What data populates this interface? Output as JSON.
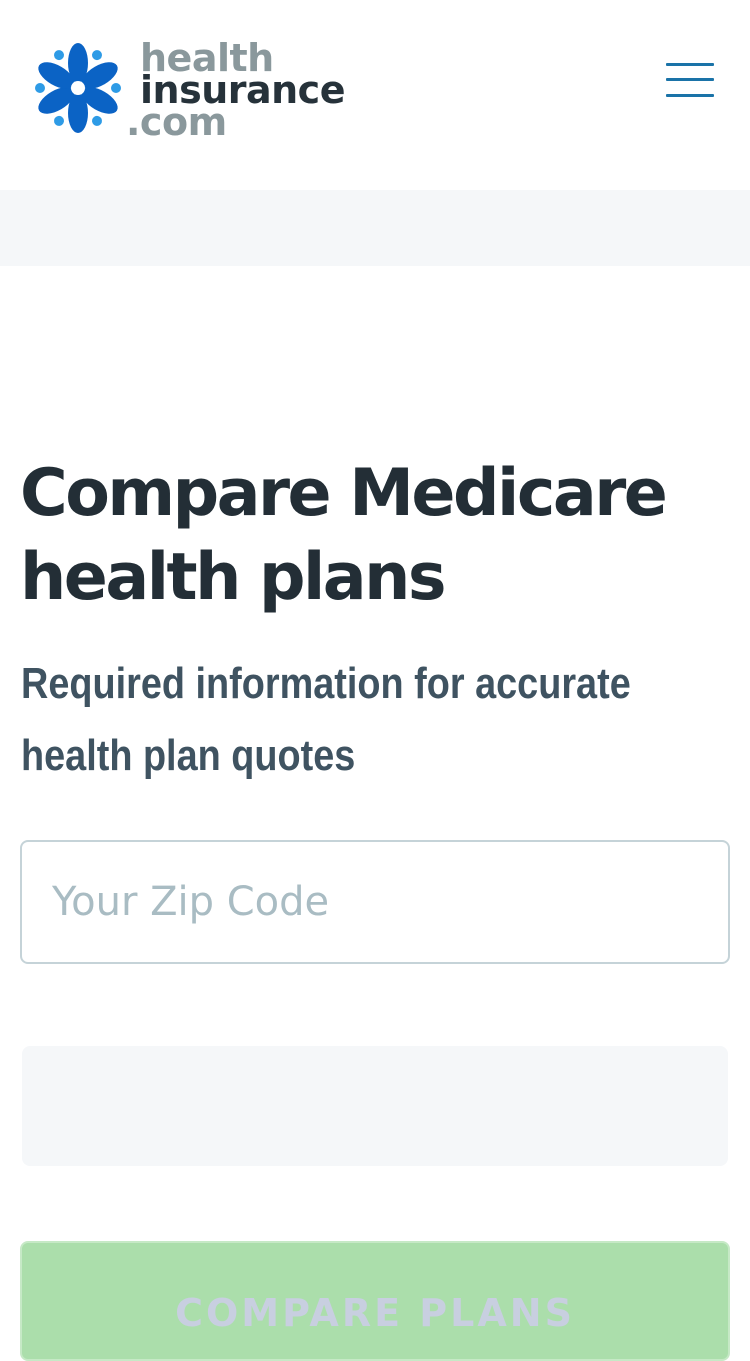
{
  "header": {
    "logo": {
      "line1": "health",
      "line2": "insurance",
      "line3": ".com",
      "icon": "flower-logo-icon"
    },
    "menu_icon": "hamburger-menu-icon"
  },
  "main": {
    "title": "Compare Medicare health plans",
    "subtitle_line1": "Required information for accurate",
    "subtitle_line2": "health plan quotes",
    "zip_field": {
      "placeholder": "Your Zip Code",
      "value": ""
    },
    "submit_label": "COMPARE PLANS"
  },
  "colors": {
    "brand_blue": "#0b63c5",
    "accent_light_blue": "#2e9be6",
    "heading": "#232e36",
    "subtitle": "#3f5361",
    "menu": "#1a73a8",
    "button_disabled": "#abdeab"
  }
}
